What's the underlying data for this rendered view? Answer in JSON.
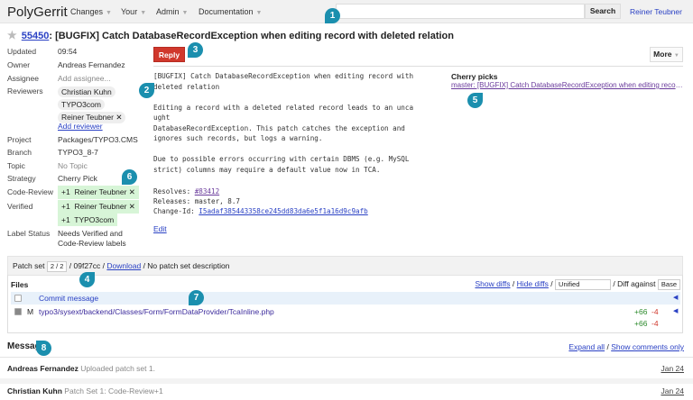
{
  "header": {
    "logo": "PolyGerrit",
    "nav": [
      "Changes",
      "Your",
      "Admin",
      "Documentation"
    ],
    "search_value": "",
    "search_label": "Search",
    "user": "Reiner Teubner"
  },
  "change": {
    "number": "55450",
    "subject": ": [BUGFIX] Catch DatabaseRecordException when editing record with deleted relation"
  },
  "meta": {
    "updated_label": "Updated",
    "updated": "09:54",
    "owner_label": "Owner",
    "owner": "Andreas Fernandez",
    "assignee_label": "Assignee",
    "assignee": "Add assignee...",
    "reviewers_label": "Reviewers",
    "reviewers": [
      "Christian Kuhn",
      "TYPO3com",
      "Reiner Teubner"
    ],
    "add_reviewer": "Add reviewer",
    "project_label": "Project",
    "project": "Packages/TYPO3.CMS",
    "branch_label": "Branch",
    "branch": "TYPO3_8-7",
    "topic_label": "Topic",
    "topic": "No Topic",
    "strategy_label": "Strategy",
    "strategy": "Cherry Pick",
    "code_review_label": "Code-Review",
    "code_review": [
      {
        "score": "+1",
        "name": "Reiner Teubner"
      }
    ],
    "verified_label": "Verified",
    "verified": [
      {
        "score": "+1",
        "name": "Reiner Teubner"
      },
      {
        "score": "+1",
        "name": "TYPO3com"
      }
    ],
    "label_status_label": "Label Status",
    "label_status": [
      "Needs Verified and",
      "Code-Review labels"
    ]
  },
  "actions": {
    "reply": "Reply",
    "more": "More"
  },
  "commit_message": {
    "lines": [
      "[BUGFIX] Catch DatabaseRecordException when editing record with",
      " deleted relation",
      "",
      "Editing a record with a deleted related record leads to an unca",
      "ught",
      "DatabaseRecordException. This patch catches the exception and",
      "ignores such records, but logs a warning.",
      "",
      "Due to possible errors occurring with certain DBMS (e.g. MySQL",
      "strict) columns may require a default value now in TCA.",
      ""
    ],
    "resolves_label": "Resolves: ",
    "resolves": "#83412",
    "releases": "Releases: master, 8.7",
    "changeid_label": "Change-Id: ",
    "changeid": "I5adaf385443358ce245dd83da6e5f1a16d9c9afb",
    "edit": "Edit"
  },
  "cherry_picks": {
    "title": "Cherry picks",
    "link": "master: [BUGFIX] Catch DatabaseRecordException when editing record..."
  },
  "patchset": {
    "label": "Patch set",
    "value": "2 / 2",
    "commit": "/ 09f27cc /",
    "download": "Download",
    "desc": "/ No patch set description"
  },
  "files": {
    "title": "Files",
    "show_diffs": "Show diffs",
    "hide_diffs": "Hide diffs",
    "sep": "/",
    "mode": "Unified",
    "diff_against_label": "/ Diff against",
    "diff_against": "Base",
    "commit_message": "Commit message",
    "rows": [
      {
        "status": "M",
        "path": "typo3/sysext/backend/Classes/Form/FormDataProvider/TcaInline.php",
        "added": "+66",
        "removed": "-4"
      }
    ],
    "total": {
      "added": "+66",
      "removed": "-4"
    }
  },
  "messages": {
    "title": "Messages",
    "expand_all": "Expand all",
    "sep": "/",
    "show_comments": "Show comments only",
    "items": [
      {
        "author": "Andreas Fernandez",
        "text": "Uploaded patch set 1.",
        "date": "Jan 24"
      },
      {
        "author": "Christian Kuhn",
        "text": "Patch Set 1: Code-Review+1",
        "date": "Jan 24"
      }
    ]
  },
  "callouts": [
    "1",
    "2",
    "3",
    "4",
    "5",
    "6",
    "7",
    "8"
  ],
  "colors": {
    "accent": "#2a41c4",
    "reply": "#d0382c",
    "callout": "#1b8fae",
    "vote": "#d7f5d7"
  }
}
